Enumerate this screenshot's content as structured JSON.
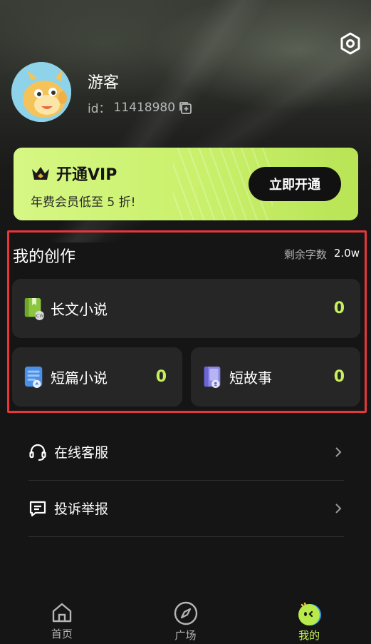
{
  "header": {
    "username": "游客",
    "id_label": "id：",
    "user_id": "11418980"
  },
  "vip": {
    "title": "开通VIP",
    "subtitle": "年费会员低至 5 折!",
    "button": "立即开通"
  },
  "creation": {
    "title": "我的创作",
    "remaining_label": "剩余字数",
    "remaining_value": "2.0w",
    "cards": [
      {
        "label": "长文小说",
        "count": "0"
      },
      {
        "label": "短篇小说",
        "count": "0"
      },
      {
        "label": "短故事",
        "count": "0"
      }
    ]
  },
  "menu": [
    {
      "label": "在线客服"
    },
    {
      "label": "投诉举报"
    }
  ],
  "tabs": [
    {
      "label": "首页"
    },
    {
      "label": "广场"
    },
    {
      "label": "我的"
    }
  ],
  "colors": {
    "accent": "#c6f05a",
    "highlight_border": "#e8373a",
    "vip_bg": "#d6f784"
  }
}
